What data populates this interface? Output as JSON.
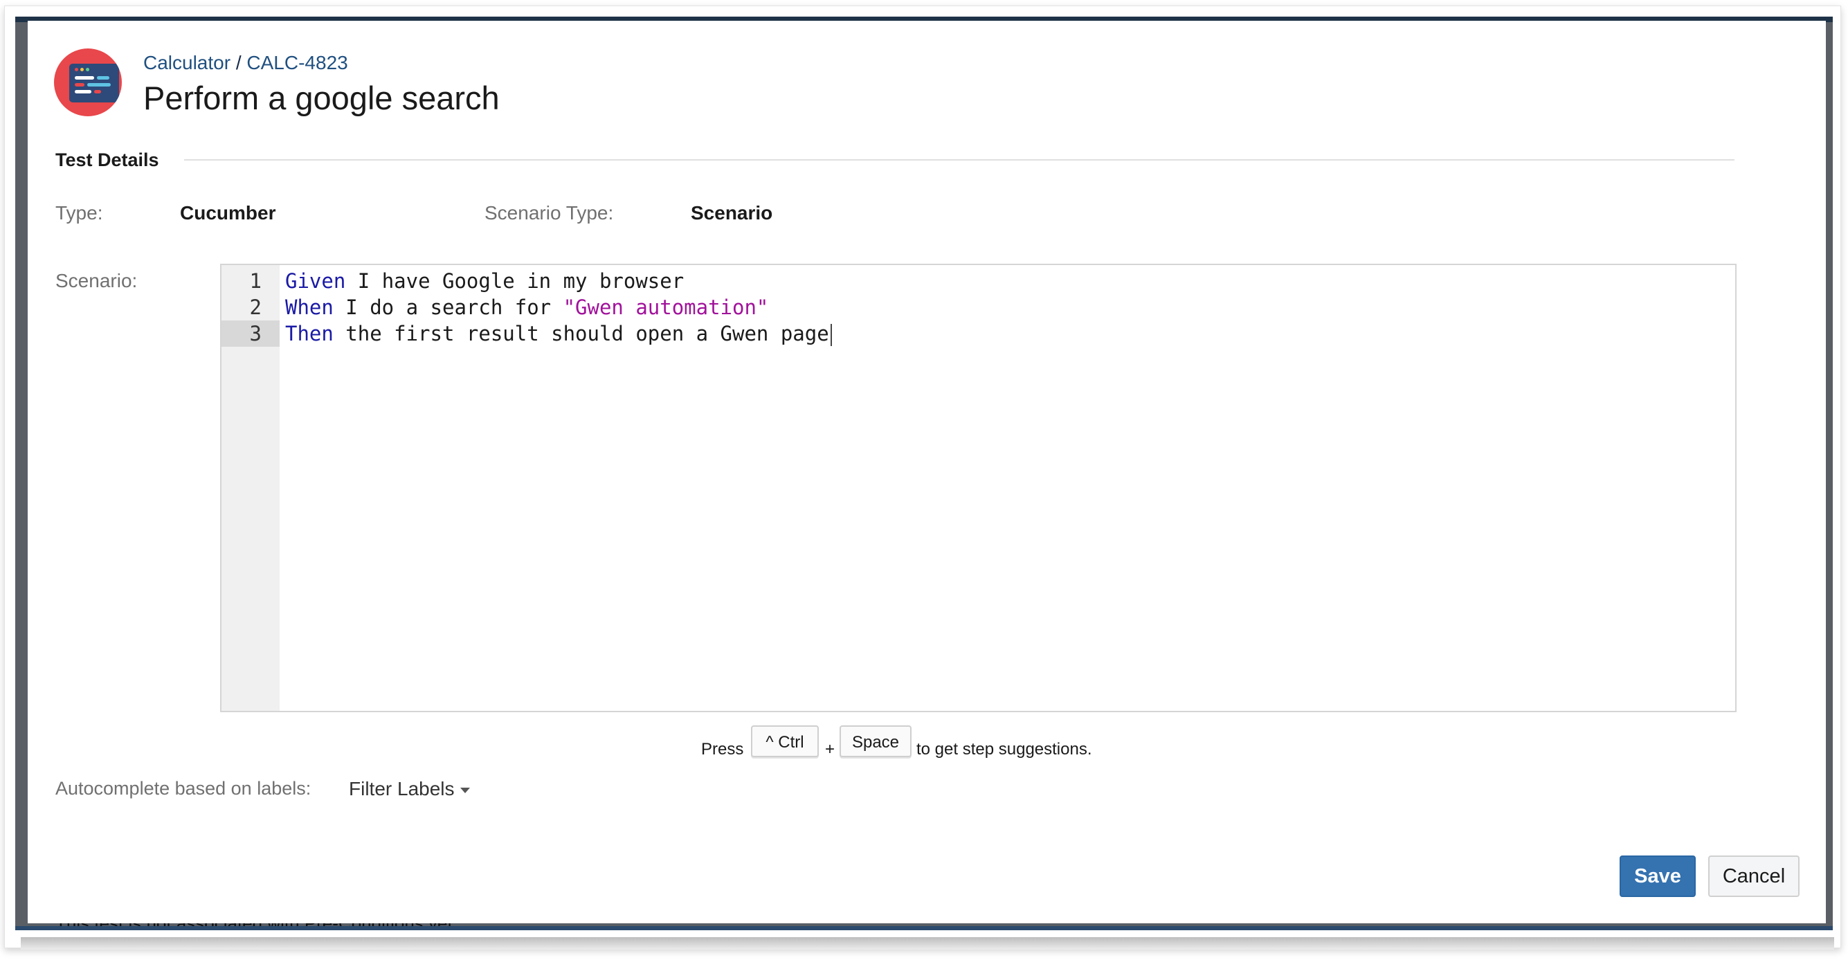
{
  "breadcrumb": {
    "project": "Calculator",
    "separator": "/",
    "issue_key": "CALC-4823"
  },
  "page_title": "Perform a google search",
  "section": {
    "heading": "Test Details"
  },
  "fields": {
    "type_label": "Type:",
    "type_value": "Cucumber",
    "scenario_type_label": "Scenario Type:",
    "scenario_type_value": "Scenario",
    "scenario_label": "Scenario:"
  },
  "editor": {
    "lines": [
      {
        "number": "1",
        "keyword": "Given",
        "text": " I have Google in my browser",
        "string": ""
      },
      {
        "number": "2",
        "keyword": "When",
        "text": " I do a search for ",
        "string": "\"Gwen automation\""
      },
      {
        "number": "3",
        "keyword": "Then",
        "text": " the first result should open a Gwen page",
        "string": ""
      }
    ],
    "active_line": 3,
    "keyword_color": "#1a1aa6",
    "string_color": "#a1129b"
  },
  "hint": {
    "press": "Press",
    "key1": "^ Ctrl",
    "plus": "+",
    "key2": "Space",
    "suffix": "to get step suggestions."
  },
  "autocomplete": {
    "label": "Autocomplete based on labels:",
    "dropdown": "Filter Labels"
  },
  "buttons": {
    "save": "Save",
    "cancel": "Cancel"
  },
  "colors": {
    "primary": "#3572b0",
    "link": "#205081",
    "logo": "#e8474b"
  },
  "background_text": "This test is not associated with Pre-Conditions yet."
}
